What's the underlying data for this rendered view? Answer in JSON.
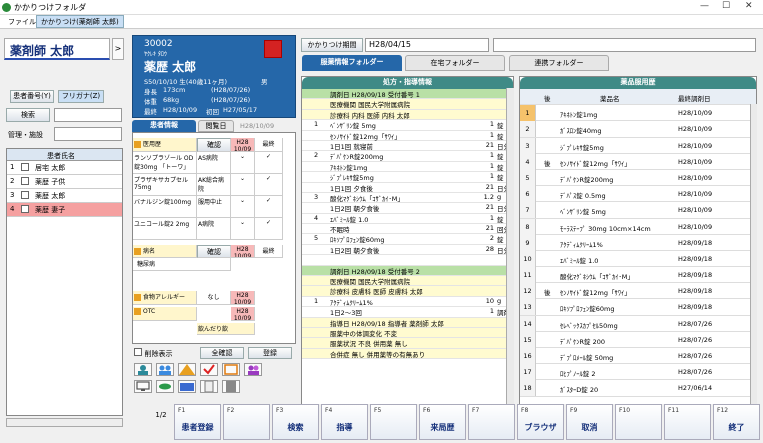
{
  "window": {
    "title": "かかりつけフォルダ",
    "controls": [
      "—",
      "☐",
      "✕"
    ]
  },
  "menu": {
    "file": "ファイル",
    "tab": "かかりつけ(薬剤師 太郎)"
  },
  "left": {
    "pharmacist": "薬剤師 太郎",
    "arrow": ">",
    "search_tabs": [
      "患者番号(",
      ")",
      "フリガナ(Z)"
    ],
    "tab_patient_no": "患者番号(Y)",
    "tab_furigana": "フリガナ(Z)",
    "search_label": "検索",
    "facility_label": "管理・施設",
    "col_patient": "患者氏名",
    "patients": [
      {
        "no": "1",
        "name": "居宅 太郎",
        "selected": false
      },
      {
        "no": "2",
        "name": "薬歴 子供",
        "selected": false
      },
      {
        "no": "3",
        "name": "薬歴 太郎",
        "selected": false
      },
      {
        "no": "4",
        "name": "薬歴 妻子",
        "selected": true
      }
    ]
  },
  "patient": {
    "id": "30002",
    "kana": "ﾔｸﾚｷ ﾀﾛｳ",
    "name": "薬歴 太郎",
    "birth": "S50/10/10 生(40歳11ヶ月)",
    "sex": "男",
    "height_label": "身長",
    "height": "173cm",
    "height_date": "(H28/07/26)",
    "weight_label": "体重",
    "weight": "68kg",
    "weight_date": "(H28/07/26)",
    "first_label": "最終",
    "first_visit": "H28/10/09",
    "start_label": "初回",
    "start_visit": "H27/05/17"
  },
  "infotabs": {
    "active": "患者情報",
    "other": "閲覧日",
    "date": "H28/10/09"
  },
  "info": {
    "sec_disease": "医用歴",
    "confirm": "確認",
    "col_date": "H28 10/09",
    "col_last": "最終",
    "drugs": [
      {
        "name": "ランソプラゾール OD錠30mg 「トーワ」",
        "hosp": "AS病院"
      },
      {
        "name": "プラザキサカプセル75mg",
        "hosp": "AK総合病院"
      },
      {
        "name": "バナルジン錠100mg",
        "hosp": "服用中止"
      },
      {
        "name": "ユニコール錠2 2mg",
        "hosp": "A病院"
      }
    ],
    "sec_disease2": "病名",
    "disease": "糖尿病",
    "sec_allergy": "食物アレルギー",
    "allergy_val": "なし",
    "allergy_date": "H28 10/09",
    "sec_otc": "OTC",
    "otc_date": "H28 10/09",
    "otc_note": "飲んだり飲",
    "delete_toggle": "削除表示",
    "all_confirm": "全確認",
    "register": "登録"
  },
  "history": {
    "label": "かかりつけ期間",
    "start": "H28/04/15"
  },
  "maintabs": [
    "服薬情報フォルダー",
    "在宅フォルダー",
    "連携フォルダー"
  ],
  "rx": {
    "title": "処方・指導情報",
    "rows": [
      {
        "n": "",
        "t": "調剤日 H28/09/18 受付番号 1",
        "q": "",
        "u": "",
        "style": "green"
      },
      {
        "n": "",
        "t": "医療機関 国民大学附属病院",
        "q": "",
        "u": "",
        "style": "yellow"
      },
      {
        "n": "",
        "t": "診療科 内科  医師 内科 太郎",
        "q": "",
        "u": "",
        "style": "yellow"
      },
      {
        "n": "1",
        "t": "ﾍﾞﾝｻﾞﾘﾝ錠 5mg",
        "q": "1",
        "u": "錠",
        "style": ""
      },
      {
        "n": "",
        "t": "ｾﾝﾉｻｲﾄﾞ錠12mg「ｻﾜｲ」",
        "q": "1",
        "u": "錠",
        "style": ""
      },
      {
        "n": "",
        "t": "1日1回 就寝前",
        "q": "21",
        "u": "日分",
        "style": ""
      },
      {
        "n": "2",
        "t": "ﾃﾞﾊﾟｹﾝR錠200mg",
        "q": "1",
        "u": "錠",
        "style": ""
      },
      {
        "n": "",
        "t": "ｱｷﾈﾄﾝ錠1mg",
        "q": "1",
        "u": "錠",
        "style": ""
      },
      {
        "n": "",
        "t": "ｼﾞﾌﾟﾚｷｻ錠5mg",
        "q": "1",
        "u": "錠",
        "style": ""
      },
      {
        "n": "",
        "t": "1日1回 夕食後",
        "q": "21",
        "u": "日分",
        "style": ""
      },
      {
        "n": "3",
        "t": "酸化ﾏｸﾞﾈｼｳﾑ「ｺｻﾞｶｲ･M」",
        "q": "1.2",
        "u": "g",
        "style": ""
      },
      {
        "n": "",
        "t": "1日2回 朝夕食後",
        "q": "21",
        "u": "日分",
        "style": ""
      },
      {
        "n": "4",
        "t": "ｴﾊﾞﾐｰﾙ錠 1.0",
        "q": "1",
        "u": "錠",
        "style": ""
      },
      {
        "n": "",
        "t": "不眠時",
        "q": "21",
        "u": "回分",
        "style": ""
      },
      {
        "n": "5",
        "t": "ﾛｷｿﾌﾟﾛﾌｪﾝ錠60mg",
        "q": "2",
        "u": "錠",
        "style": ""
      },
      {
        "n": "",
        "t": "1日2回 朝夕食後",
        "q": "28",
        "u": "日分",
        "style": ""
      },
      {
        "n": "",
        "t": "",
        "q": "",
        "u": "",
        "style": ""
      },
      {
        "n": "",
        "t": "調剤日 H28/09/18 受付番号 2",
        "q": "",
        "u": "",
        "style": "green"
      },
      {
        "n": "",
        "t": "医療機関 国民大学附属病院",
        "q": "",
        "u": "",
        "style": "yellow"
      },
      {
        "n": "",
        "t": "診療科 皮膚科  医師 皮膚科 太郎",
        "q": "",
        "u": "",
        "style": "yellow"
      },
      {
        "n": "1",
        "t": "ｱｸﾃﾞｨﾑｸﾘｰﾑ1%",
        "q": "10",
        "u": "g",
        "style": ""
      },
      {
        "n": "",
        "t": "1日2〜3回",
        "q": "1",
        "u": "調剤",
        "style": ""
      },
      {
        "n": "",
        "t": "指導日 H28/09/18  指導者 薬剤師 太郎",
        "q": "",
        "u": "",
        "style": "yellow"
      },
      {
        "n": "",
        "t": "服薬中の体調変化 不変",
        "q": "",
        "u": "",
        "style": "yellow"
      },
      {
        "n": "",
        "t": "服薬状況 不良      併用薬 無し",
        "q": "",
        "u": "",
        "style": "yellow"
      },
      {
        "n": "",
        "t": "合併症 無し       併用薬等の有無あり",
        "q": "",
        "u": "",
        "style": "yellow"
      }
    ]
  },
  "med": {
    "title": "薬品服用歴",
    "col_after": "後",
    "col_name": "薬品名",
    "col_date": "最終調剤日",
    "rows": [
      {
        "num": "1",
        "after": "",
        "name": "ｱｷﾈﾄﾝ錠1mg",
        "date": "H28/10/09"
      },
      {
        "num": "2",
        "after": "",
        "name": "ｶﾞｽﾛﾝ錠40mg",
        "date": "H28/10/09"
      },
      {
        "num": "3",
        "after": "",
        "name": "ｼﾞﾌﾟﾚｷｻ錠5mg",
        "date": "H28/10/09"
      },
      {
        "num": "4",
        "after": "後",
        "name": "ｾﾝﾉｻｲﾄﾞ錠12mg「ｻﾜｲ」",
        "date": "H28/10/09"
      },
      {
        "num": "5",
        "after": "",
        "name": "ﾃﾞﾊﾟｹﾝR錠200mg",
        "date": "H28/10/09"
      },
      {
        "num": "6",
        "after": "",
        "name": "ﾃﾞﾊﾟｽ錠 0.5mg",
        "date": "H28/10/09"
      },
      {
        "num": "7",
        "after": "",
        "name": "ﾍﾞﾝｻﾞﾘﾝ錠 5mg",
        "date": "H28/10/09"
      },
      {
        "num": "8",
        "after": "",
        "name": "ﾓｰﾗｽﾃｰﾌﾟ 30mg 10cm×14cm",
        "date": "H28/10/09"
      },
      {
        "num": "9",
        "after": "",
        "name": "ｱｸﾃﾞｨﾑｸﾘｰﾑ1%",
        "date": "H28/09/18"
      },
      {
        "num": "10",
        "after": "",
        "name": "ｴﾊﾞﾐｰﾙ錠 1.0",
        "date": "H28/09/18"
      },
      {
        "num": "11",
        "after": "",
        "name": "酸化ﾏｸﾞﾈｼｳﾑ「ｺｻﾞｶｲ･M」",
        "date": "H28/09/18"
      },
      {
        "num": "12",
        "after": "後",
        "name": "ｾﾝﾉｻｲﾄﾞ錠12mg「ｻﾜｲ」",
        "date": "H28/09/18"
      },
      {
        "num": "13",
        "after": "",
        "name": "ﾛｷｿﾌﾟﾛﾌｪﾝ錠60mg",
        "date": "H28/09/18"
      },
      {
        "num": "14",
        "after": "",
        "name": "ｾﾚﾍﾞｯｸｽｶﾌﾟｾﾙ50mg",
        "date": "H28/07/26"
      },
      {
        "num": "15",
        "after": "",
        "name": "ﾃﾞﾊﾟｹﾝR錠 200",
        "date": "H28/07/26"
      },
      {
        "num": "16",
        "after": "",
        "name": "ﾃﾞﾌﾟﾛﾒｰﾙ錠 50mg",
        "date": "H28/07/26"
      },
      {
        "num": "17",
        "after": "",
        "name": "ﾛﾋﾌﾟﾉｰﾙ錠 2",
        "date": "H28/07/26"
      },
      {
        "num": "18",
        "after": "",
        "name": "ｶﾞｽﾀｰD錠 20",
        "date": "H27/06/14"
      }
    ]
  },
  "fkeys": {
    "page": "1/2",
    "keys": [
      {
        "k": "F1",
        "l": "患者登録"
      },
      {
        "k": "F2",
        "l": ""
      },
      {
        "k": "F3",
        "l": "検索"
      },
      {
        "k": "F4",
        "l": "指導"
      },
      {
        "k": "F5",
        "l": ""
      },
      {
        "k": "F6",
        "l": "来局歴"
      },
      {
        "k": "F7",
        "l": ""
      },
      {
        "k": "F8",
        "l": "ブラウザ"
      },
      {
        "k": "F9",
        "l": "取消"
      },
      {
        "k": "F10",
        "l": ""
      },
      {
        "k": "F11",
        "l": ""
      },
      {
        "k": "F12",
        "l": "終了"
      }
    ]
  }
}
